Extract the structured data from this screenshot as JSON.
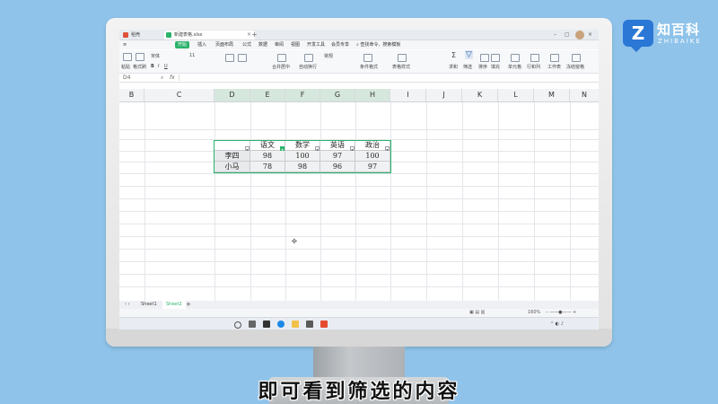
{
  "brand": {
    "cn": "知百科",
    "en": "ZHIBAIKE",
    "mark": "Z"
  },
  "app": {
    "tabs": [
      {
        "label": "稻壳"
      },
      {
        "label": "新建表格.xlsx"
      }
    ],
    "menu": [
      "开始",
      "插入",
      "页面布局",
      "公式",
      "数据",
      "审阅",
      "视图",
      "开发工具",
      "会员专享",
      "查找命令、搜索模板"
    ],
    "ribbon": [
      "粘贴",
      "格式刷",
      "宋体",
      "11",
      "B",
      "I",
      "U",
      "合并居中",
      "自动换行",
      "常规",
      "条件格式",
      "表格样式",
      "求和",
      "筛选",
      "排序",
      "填充",
      "单元格",
      "行和列",
      "工作表",
      "冻结窗格"
    ],
    "formula": {
      "cell_ref": "D4",
      "fx": "fx"
    },
    "columns": [
      "B",
      "C",
      "D",
      "E",
      "F",
      "G",
      "H",
      "I",
      "J",
      "K",
      "L",
      "M",
      "N"
    ],
    "selected_columns": [
      "D",
      "E",
      "F",
      "G",
      "H"
    ],
    "table": {
      "headers": [
        "",
        "语文",
        "数学",
        "英语",
        "政治"
      ],
      "rows": [
        [
          "李四",
          "98",
          "100",
          "97",
          "100"
        ],
        [
          "小马",
          "78",
          "98",
          "96",
          "97"
        ]
      ],
      "active_filter_column": "语文"
    },
    "sheets": [
      "Sheet1",
      "Sheet2"
    ],
    "active_sheet": "Sheet2",
    "status": {
      "zoom": "160%"
    }
  },
  "subtitle": "即可看到筛选的内容",
  "colors": {
    "accent": "#2bb36b",
    "background": "#8fc3ea"
  }
}
